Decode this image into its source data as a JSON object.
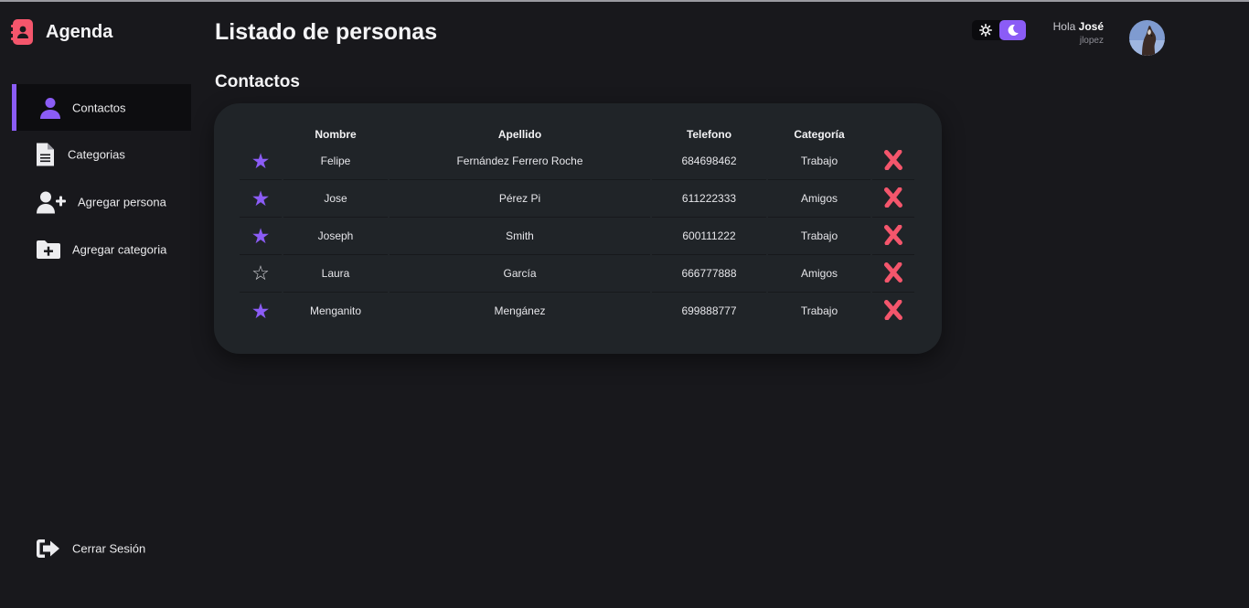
{
  "app": {
    "title": "Agenda"
  },
  "sidebar": {
    "items": [
      {
        "label": "Contactos",
        "icon": "user-icon",
        "active": true
      },
      {
        "label": "Categorias",
        "icon": "document-icon",
        "active": false
      },
      {
        "label": "Agregar persona",
        "icon": "user-plus-icon",
        "active": false
      },
      {
        "label": "Agregar categoria",
        "icon": "folder-plus-icon",
        "active": false
      }
    ],
    "logout": {
      "label": "Cerrar Sesión",
      "icon": "logout-icon"
    }
  },
  "header": {
    "title": "Listado de personas",
    "section": "Contactos",
    "theme": {
      "mode": "dark",
      "sun_icon": "sun-icon",
      "moon_icon": "moon-icon"
    },
    "user": {
      "greeting": "Hola",
      "name": "José",
      "username": "jlopez"
    }
  },
  "table": {
    "columns": [
      "Nombre",
      "Apellido",
      "Telefono",
      "Categoría"
    ],
    "rows": [
      {
        "favorite": true,
        "nombre": "Felipe",
        "apellido": "Fernández Ferrero Roche",
        "telefono": "684698462",
        "categoria": "Trabajo"
      },
      {
        "favorite": true,
        "nombre": "Jose",
        "apellido": "Pérez Pi",
        "telefono": "611222333",
        "categoria": "Amigos"
      },
      {
        "favorite": true,
        "nombre": "Joseph",
        "apellido": "Smith",
        "telefono": "600111222",
        "categoria": "Trabajo"
      },
      {
        "favorite": false,
        "nombre": "Laura",
        "apellido": "García",
        "telefono": "666777888",
        "categoria": "Amigos"
      },
      {
        "favorite": true,
        "nombre": "Menganito",
        "apellido": "Mengánez",
        "telefono": "699888777",
        "categoria": "Trabajo"
      }
    ]
  },
  "colors": {
    "accent": "#8b5cf6",
    "danger": "#f4566c",
    "background": "#18181c",
    "card": "#202428"
  }
}
